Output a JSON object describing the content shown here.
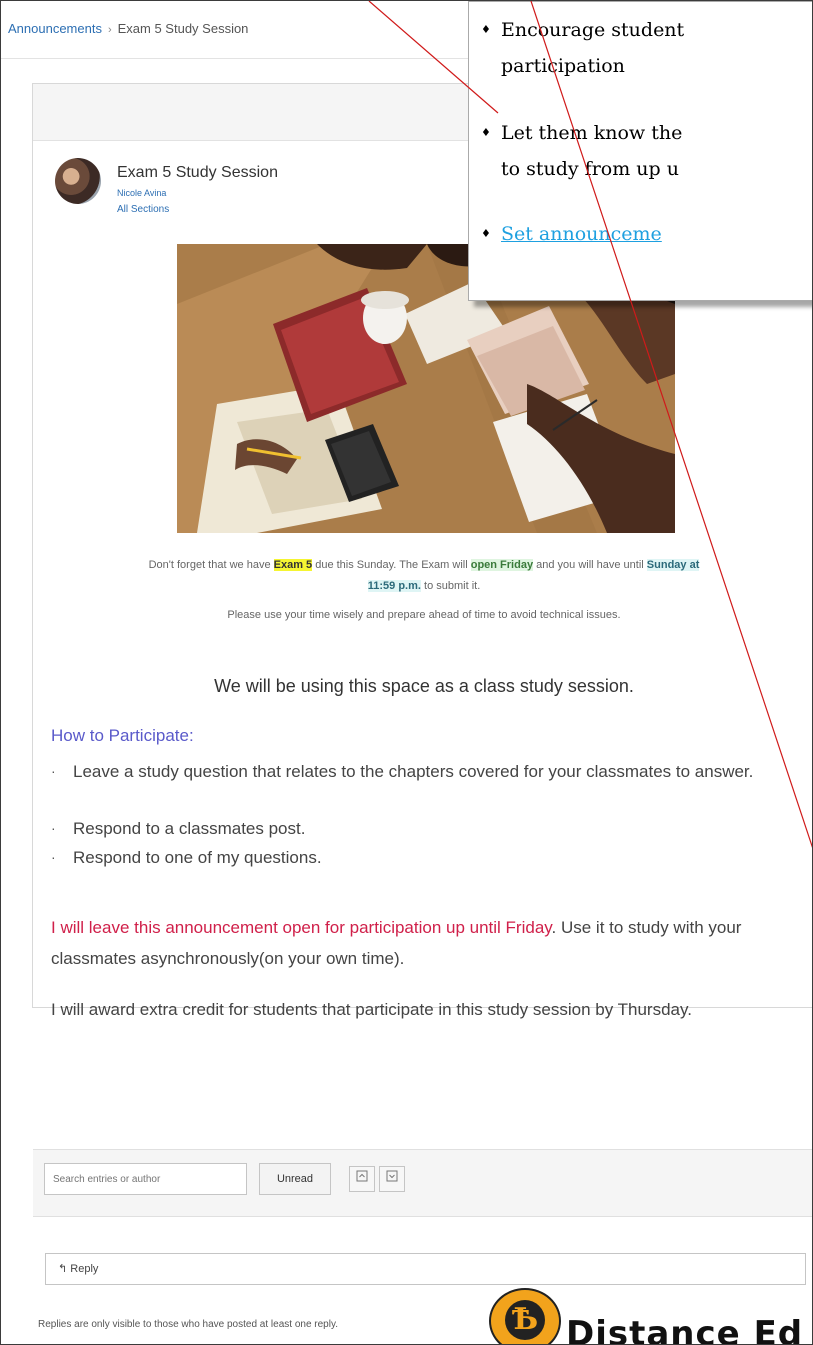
{
  "breadcrumb": {
    "root": "Announcements",
    "current": "Exam 5 Study Session"
  },
  "post": {
    "title": "Exam 5 Study Session",
    "author": "Nicole Avina",
    "sections": "All Sections"
  },
  "message": {
    "line1_a": "Don't forget that we have ",
    "line1_exam": "Exam 5",
    "line1_b": " due this Sunday. The Exam will ",
    "line1_open": "open Friday",
    "line1_c": " and you will have until ",
    "line1_due": "Sunday at",
    "line1_due2": "11:59 p.m.",
    "line1_d": " to submit it.",
    "line2": "Please use your time wisely and prepare ahead of time to avoid technical issues."
  },
  "heading": "We will be using this space as a class study session.",
  "how_to": {
    "title": "How to Participate:",
    "items": [
      "Leave a study question that relates to the chapters covered for your classmates to answer.",
      "Respond to a classmates post.",
      "Respond to one of my questions."
    ]
  },
  "para1": {
    "red": "I will leave this announcement open for participation up until Friday",
    "rest": ". Use it to study with your classmates asynchronously(on your own time)."
  },
  "para2": "I will award extra credit for students that participate in this study session by Thursday.",
  "toolbar": {
    "search_placeholder": "Search entries or author",
    "unread": "Unread"
  },
  "reply": {
    "label": "Reply",
    "arrow": "↰"
  },
  "footnote": "Replies are only visible to those who have posted at least one reply.",
  "callout": {
    "bullets": [
      "Encourage student",
      "participation",
      "Let them know the",
      "to study from up u",
      "Set announceme"
    ],
    "bullet_glyph": "♦"
  },
  "logo": {
    "mark": "Ѣ",
    "text": "Distance Ed"
  },
  "colors": {
    "accent": "#2d6fb3",
    "red": "#d0204a",
    "heading_purple": "#5a5aca",
    "page_bg": "#f6f0c5",
    "callout_link": "#1ea0e0"
  }
}
